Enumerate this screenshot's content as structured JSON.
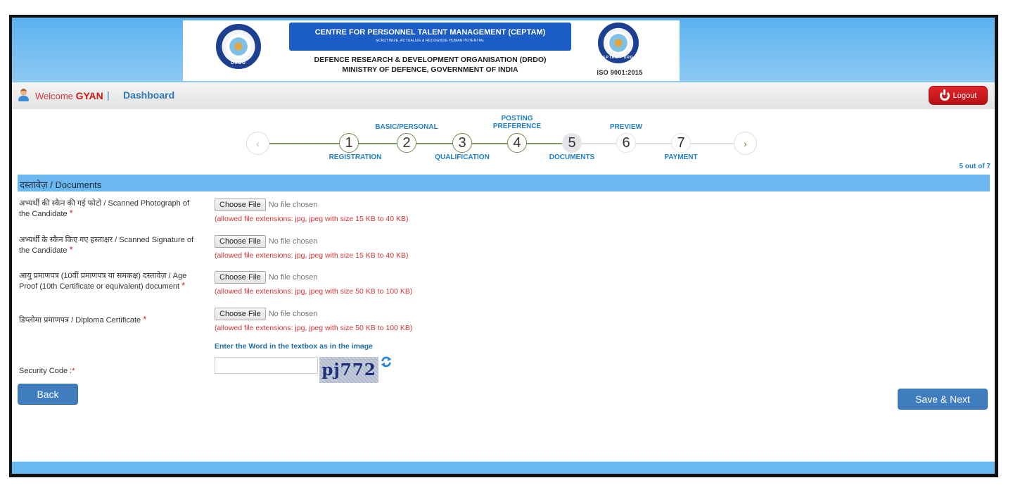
{
  "header": {
    "org_title": "CENTRE FOR PERSONNEL TALENT MANAGEMENT (CEPTAM)",
    "org_tagline": "SCRUTINIZE, ACTUALIZE & RECOGNIZE HUMAN POTENTIAL",
    "parent_org": "DEFENCE RESEARCH & DEVELOPMENT ORGANISATION (DRDO)",
    "ministry": "MINISTRY OF DEFENCE, GOVERNMENT OF INDIA",
    "left_emblem_text": "DRDO",
    "right_emblem_text": "CEPTAM - DRDO",
    "iso_text": "ISO 9001:2015"
  },
  "userbar": {
    "welcome_prefix": "Welcome ",
    "username": "GYAN",
    "separator": "|",
    "dashboard_label": "Dashboard",
    "logout_label": "Logout"
  },
  "stepper": {
    "prev_icon": "‹",
    "next_icon": "›",
    "steps": [
      {
        "number": "1",
        "label": "REGISTRATION",
        "status": "done"
      },
      {
        "number": "2",
        "label": "BASIC/PERSONAL",
        "status": "done"
      },
      {
        "number": "3",
        "label": "QUALIFICATION",
        "status": "done"
      },
      {
        "number": "4",
        "label_line1": "POSTING",
        "label_line2": "PREFERENCE",
        "status": "done"
      },
      {
        "number": "5",
        "label": "DOCUMENTS",
        "status": "current"
      },
      {
        "number": "6",
        "label": "PREVIEW",
        "status": "todo"
      },
      {
        "number": "7",
        "label": "PAYMENT",
        "status": "todo"
      }
    ],
    "current_step": 5,
    "total_steps": 7,
    "progress_text": "5 out of 7"
  },
  "documents": {
    "section_title": "दस्तावेज़ / Documents",
    "choose_file_label": "Choose File",
    "no_file_text": "No file chosen",
    "required_mark": "*",
    "fields": [
      {
        "label_line1": "अभ्यर्थी की स्कैन की गई फोटो / Scanned Photograph of",
        "label_line2": "the Candidate",
        "hint": "(allowed file extensions: jpg, jpeg with size 15 KB to 40 KB)"
      },
      {
        "label_line1": "अभ्यर्थी के स्कैन किए गए हस्ताक्षर / Scanned Signature of",
        "label_line2": "the Candidate",
        "hint": "(allowed file extensions: jpg, jpeg with size 15 KB to 40 KB)"
      },
      {
        "label_line1": "आयु प्रमाणपत्र (10वीं प्रमाणपत्र या समकक्ष) दस्तावेज़ / Age",
        "label_line2": "Proof (10th Certificate or equivalent) document",
        "hint": "(allowed file extensions: jpg, jpeg with size 50 KB to 100 KB)"
      },
      {
        "label_line1": "डिप्लोमा प्रमाणपत्र / Diploma Certificate",
        "label_line2": "",
        "hint": "(allowed file extensions: jpg, jpeg with size 50 KB to 100 KB)"
      }
    ],
    "captcha_prompt": "Enter the Word in the textbox as in the image",
    "security_label": "Security Code :",
    "security_value": "",
    "captcha_text": "pj772"
  },
  "actions": {
    "back_label": "Back",
    "save_next_label": "Save & Next"
  },
  "colors": {
    "header_blue": "#5bb1ef",
    "section_blue": "#6bb9f0",
    "link_blue": "#1f7fc4",
    "button_blue": "#3f7dbf",
    "logout_red": "#d01818",
    "hint_red": "#d63434",
    "step_green": "#789a5c"
  }
}
